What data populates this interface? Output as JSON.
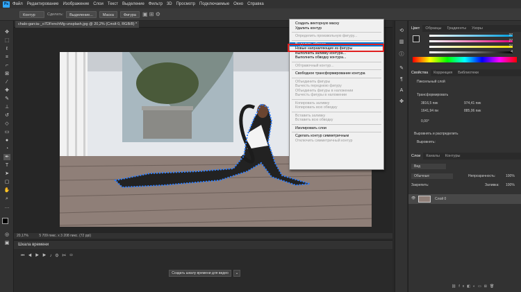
{
  "app": {
    "logo": "Ps",
    "colors": {
      "accent": "#31a8ff",
      "selection": "#0078d7",
      "highlight": "#e02020"
    }
  },
  "menu": [
    "Файл",
    "Редактирование",
    "Изображение",
    "Слои",
    "Текст",
    "Выделение",
    "Фильтр",
    "3D",
    "Просмотр",
    "Подключаемые",
    "Окно",
    "Справка"
  ],
  "options": {
    "mode": "Контур",
    "make_label": "Сделать:",
    "selection": "Выделение...",
    "mask": "Маска",
    "shape": "Фигура"
  },
  "document": {
    "tab": "chalo-garcia-_o7DFenchMg-unsplash.jpg @ 20,2% (Слой 0, RGB/8) *",
    "close": "×"
  },
  "status": {
    "zoom": "20,17%",
    "info": "5 709 пикс. x 3 208 пикс. (72 ppi)"
  },
  "timeline": {
    "title": "Шкала времени",
    "create_button": "Создать шкалу времени для видео"
  },
  "context_menu": {
    "items": [
      {
        "label": "Создать векторную маску",
        "disabled": false
      },
      {
        "label": "Удалить контур",
        "disabled": false
      },
      {
        "sep": true
      },
      {
        "label": "Определить произвольную фигуру...",
        "disabled": true
      },
      {
        "sep": true
      },
      {
        "label": "Выделить область...",
        "disabled": false,
        "selected": true
      },
      {
        "label": "Новые направляющие из фигуры",
        "disabled": false
      },
      {
        "label": "Выполнить заливку контура...",
        "disabled": false
      },
      {
        "label": "Выполнить обводку контура...",
        "disabled": false
      },
      {
        "sep": true
      },
      {
        "label": "Обтравочный контур...",
        "disabled": true
      },
      {
        "sep": true
      },
      {
        "label": "Свободное трансформирование контура",
        "disabled": false
      },
      {
        "sep": true
      },
      {
        "label": "Объединить фигуры",
        "disabled": true
      },
      {
        "label": "Вычесть переднюю фигуру",
        "disabled": true
      },
      {
        "label": "Объединить фигуры в наложении",
        "disabled": true
      },
      {
        "label": "Вычесть фигуры в наложении",
        "disabled": true
      },
      {
        "sep": true
      },
      {
        "label": "Копировать заливку",
        "disabled": true
      },
      {
        "label": "Копировать всю обводку",
        "disabled": true
      },
      {
        "sep": true
      },
      {
        "label": "Вставить заливку",
        "disabled": true
      },
      {
        "label": "Вставить всю обводку",
        "disabled": true
      },
      {
        "sep": true
      },
      {
        "label": "Изолировать слои",
        "disabled": false
      },
      {
        "sep": true
      },
      {
        "label": "Сделать контур симметричным",
        "disabled": false
      },
      {
        "label": "Отключить симметричный контур",
        "disabled": true
      }
    ]
  },
  "color_panel": {
    "tabs": [
      "Цвет",
      "Образцы",
      "Градиенты",
      "Узоры"
    ],
    "values": [
      "37",
      "27",
      "27",
      "4"
    ]
  },
  "properties_panel": {
    "tabs": [
      "Свойства",
      "Коррекция",
      "Библиотеки"
    ],
    "layer_label": "Пиксельный слой",
    "transform_label": "Трансформировать",
    "w": "3816,5 пик",
    "h": "1641,94 пи",
    "x": "974,41 пик",
    "y": "885,06 пик",
    "angle": "0,00°",
    "align_label": "Выровнять и распределить",
    "align_sub": "Выровнять:"
  },
  "layers_panel": {
    "tabs": [
      "Слои",
      "Каналы",
      "Контуры"
    ],
    "search": "Вид",
    "blend": "Обычные",
    "opacity_label": "Непрозрачность:",
    "opacity": "100%",
    "lock_label": "Закрепить:",
    "fill_label": "Заливка:",
    "fill": "100%",
    "layer_name": "Слой 0"
  }
}
